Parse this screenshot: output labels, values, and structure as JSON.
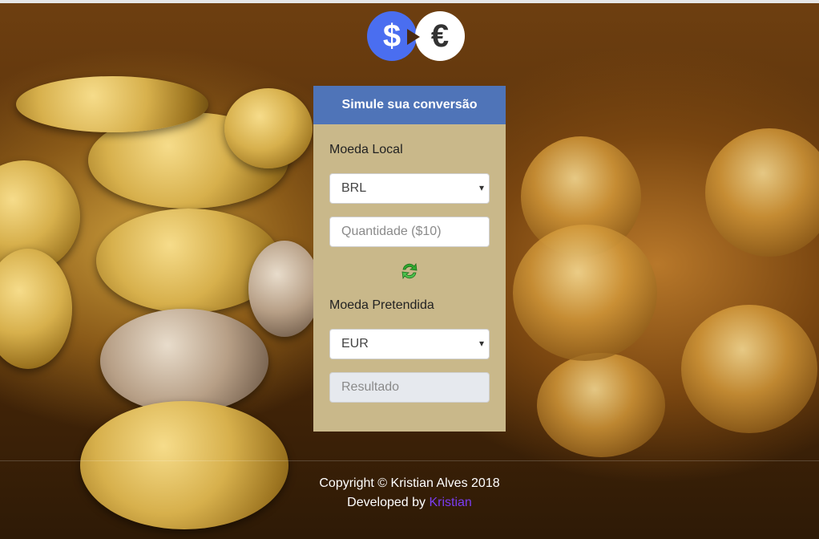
{
  "logo": {
    "from_symbol": "$",
    "to_symbol": "€"
  },
  "panel": {
    "title": "Simule sua conversão",
    "local_label": "Moeda Local",
    "local_currency": "BRL",
    "amount_placeholder": "Quantidade ($10)",
    "target_label": "Moeda Pretendida",
    "target_currency": "EUR",
    "result_placeholder": "Resultado"
  },
  "footer": {
    "copyright": "Copyright © Kristian Alves 2018",
    "developed_prefix": "Developed by",
    "developer_link": "Kristian"
  },
  "colors": {
    "header_blue": "#4f74b8",
    "panel_beige": "#c9b88a",
    "link_purple": "#7a3cf0"
  }
}
